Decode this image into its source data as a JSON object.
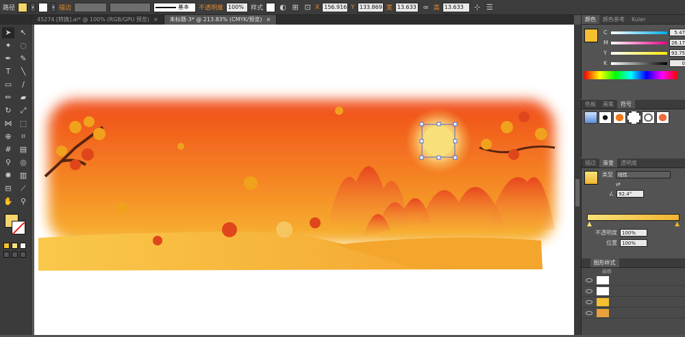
{
  "control_bar": {
    "object_type": "路径",
    "stroke_label": "描边",
    "stroke_profile": "基本",
    "opacity_label": "不透明度",
    "opacity_value": "100%",
    "style_label": "样式",
    "x_label": "X",
    "x_value": "156.916",
    "y_label": "Y",
    "y_value": "133.869",
    "w_label": "宽",
    "w_value": "13.633",
    "h_label": "高",
    "h_value": "13.633 m",
    "fill_color": "#f4d56a"
  },
  "documents": [
    {
      "label": "45274 [转换].ai* @ 100% (RGB/GPU 预览)",
      "active": false
    },
    {
      "label": "未标题-3* @ 213.83% (CMYK/预览)",
      "active": true
    }
  ],
  "color_panel": {
    "tabs": [
      "颜色",
      "颜色参考",
      "Kuler"
    ],
    "swatch": "#f4c030",
    "sliders": [
      {
        "key": "C",
        "value": "5.47",
        "gradient": "linear-gradient(90deg,#fff,#00aeef)"
      },
      {
        "key": "M",
        "value": "26.17",
        "gradient": "linear-gradient(90deg,#fff,#ec008c)"
      },
      {
        "key": "Y",
        "value": "93.75",
        "gradient": "linear-gradient(90deg,#fff,#ffec00)"
      },
      {
        "key": "K",
        "value": "0",
        "gradient": "linear-gradient(90deg,#fff,#000)"
      }
    ]
  },
  "symbols_panel": {
    "tabs": [
      "色板",
      "画笔",
      "符号"
    ],
    "active": "符号"
  },
  "gradient_panel": {
    "tabs": [
      "描边",
      "渐变",
      "透明度"
    ],
    "type_label": "类型",
    "type_value": "线性",
    "angle_value": "92.4°",
    "opacity_label": "不透明度",
    "opacity_value": "100%",
    "position_label": "位置",
    "position_value": "100%",
    "gradient_start": "#f6e27a",
    "gradient_end": "#f2b430"
  },
  "layers_panel": {
    "tabs": [
      "图形样式"
    ],
    "subtab": "画板"
  }
}
